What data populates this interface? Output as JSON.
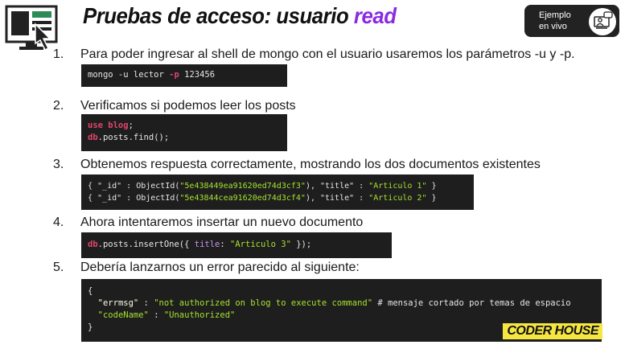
{
  "title": {
    "main": "Pruebas de acceso: usuario ",
    "highlight": "read"
  },
  "badge": {
    "line1": "Ejemplo",
    "line2": "en vivo"
  },
  "steps": [
    {
      "num": "1.",
      "text": "Para poder ingresar al shell de mongo con el usuario usaremos los parámetros -u y -p."
    },
    {
      "num": "2.",
      "text": "Verificamos si podemos leer los posts"
    },
    {
      "num": "3.",
      "text": "Obtenemos respuesta correctamente, mostrando los dos documentos existentes"
    },
    {
      "num": "4.",
      "text": "Ahora intentaremos insertar un nuevo documento"
    },
    {
      "num": "5.",
      "text": "Debería lanzarnos un error parecido al siguiente:"
    }
  ],
  "code1": {
    "pre": "mongo -u lector ",
    "flag": "-p",
    "post": " 123456"
  },
  "code2": {
    "l1_kw": "use blog",
    "l1_end": ";",
    "l2_kw": "db",
    "l2_rest": ".posts.find();"
  },
  "code3": {
    "r1_a": "{ \"_id\" : ObjectId(",
    "r1_id": "\"5e438449ea91620ed74d3cf3\"",
    "r1_b": "), \"title\" : ",
    "r1_t": "\"Articulo 1\"",
    "r1_c": " }",
    "r2_a": "{ \"_id\" : ObjectId(",
    "r2_id": "\"5e43844cea91620ed74d3cf4\"",
    "r2_b": "), \"title\" : ",
    "r2_t": "\"Articulo 2\"",
    "r2_c": " }"
  },
  "code4": {
    "kw": "db",
    "a": ".posts.insertOne({ ",
    "prop": "title",
    "b": ": ",
    "str": "\"Articulo 3\"",
    "c": " });"
  },
  "code5": {
    "open": "{",
    "k1": "\"errmsg\"",
    "s1": " : ",
    "v1": "\"not authorized on blog to execute command\"",
    "c1": " # mensaje cortado por temas de espacio",
    "k2": "\"codeName\"",
    "s2": " : ",
    "v2": "\"Unauthorized\"",
    "close": "}"
  },
  "brand": "CODER HOUSE",
  "colors": {
    "highlight": "#8a2be2",
    "code_bg": "#1e1e1e",
    "keyword": "#e0456b",
    "string": "#a6e22e",
    "brand_bg": "#f5e642"
  }
}
